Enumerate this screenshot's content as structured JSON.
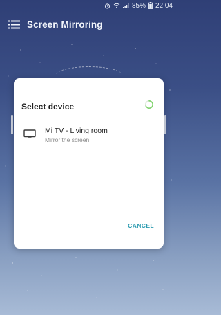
{
  "status_bar": {
    "battery": "85%",
    "time": "22:04",
    "icons": [
      "alarm-icon",
      "wifi-icon",
      "signal-icon",
      "battery-icon"
    ]
  },
  "app_bar": {
    "menu_icon": "list-menu-icon",
    "title": "Screen Mirroring"
  },
  "dialog": {
    "title": "Select device",
    "spinner_icon": "loading-spinner-icon",
    "devices": [
      {
        "icon": "tv-icon",
        "name": "Mi TV - Living room",
        "subtitle": "Mirror the screen."
      }
    ],
    "cancel_label": "CANCEL"
  },
  "colors": {
    "accent": "#2c9bb0",
    "background_top": "#2f3f76",
    "background_bottom": "#a8bbd6",
    "dialog_background": "#ffffff",
    "spinner_green": "#7fd36c"
  }
}
